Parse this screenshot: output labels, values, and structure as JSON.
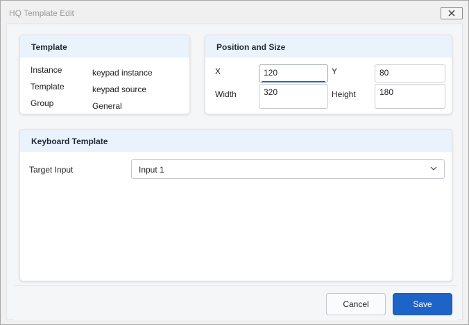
{
  "window": {
    "title": "HQ Template Edit",
    "close_icon": "close-icon"
  },
  "template_card": {
    "header": "Template",
    "rows": [
      {
        "label": "Instance",
        "value": "keypad instance"
      },
      {
        "label": "Template",
        "value": "keypad source"
      },
      {
        "label": "Group",
        "value": "General"
      }
    ]
  },
  "position_card": {
    "header": "Position and Size",
    "x_label": "X",
    "x_value": "120",
    "y_label": "Y",
    "y_value": "80",
    "width_label": "Width",
    "width_value": "320",
    "height_label": "Height",
    "height_value": "180"
  },
  "keyboard_card": {
    "header": "Keyboard Template",
    "target_label": "Target Input",
    "target_value": "Input 1",
    "dropdown_icon": "chevron-down-icon"
  },
  "footer": {
    "cancel_label": "Cancel",
    "save_label": "Save"
  },
  "colors": {
    "accent": "#1e64c8",
    "header_bg": "#eaf2fc"
  }
}
